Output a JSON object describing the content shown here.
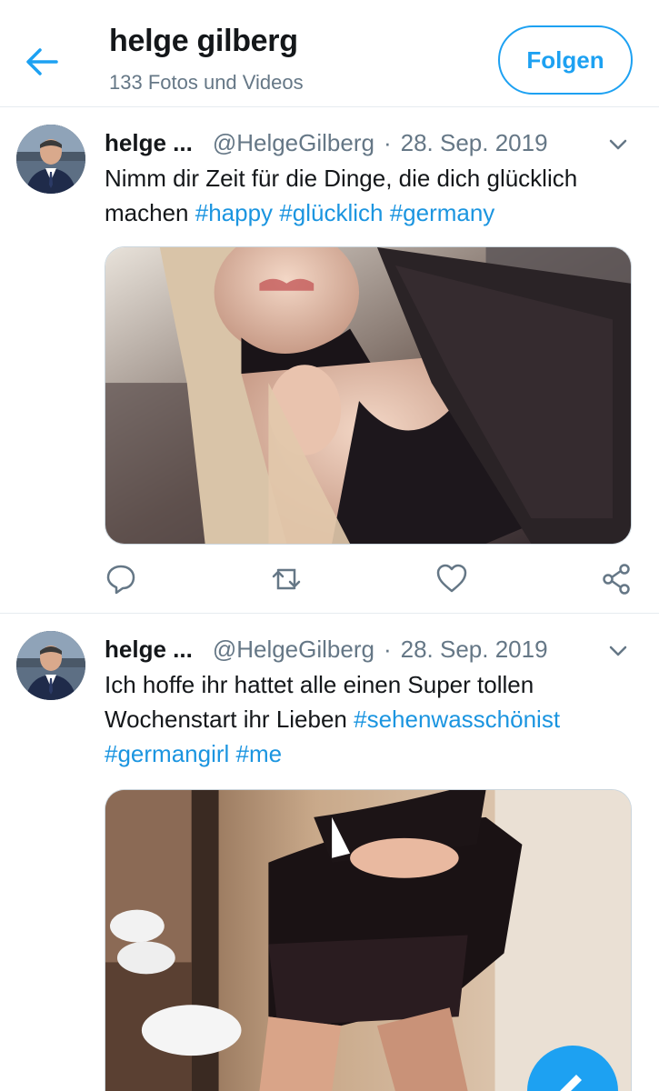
{
  "header": {
    "title": "helge gilberg",
    "subtitle": "133 Fotos und Videos",
    "follow_label": "Folgen"
  },
  "tweets": [
    {
      "name": "helge ...",
      "handle": "@HelgeGilberg",
      "separator": "·",
      "date": "28. Sep. 2019",
      "text_plain_1": "Nimm dir Zeit für die Dinge, die dich glücklich machen ",
      "hashtags": [
        "#happy",
        "#glücklich",
        "#germany"
      ],
      "media_description_icon": "photo-selfie-black-lace-top"
    },
    {
      "name": "helge ...",
      "handle": "@HelgeGilberg",
      "separator": "·",
      "date": "28. Sep. 2019",
      "text_plain_1": "Ich hoffe ihr hattet alle einen Super tollen Wochenstart ihr Lieben ",
      "hashtags": [
        "#sehenwasschönist",
        "#germangirl",
        "#me"
      ],
      "media_description_icon": "photo-mirror-selfie-black-dress"
    }
  ],
  "icons": {
    "back": "arrow-left-icon",
    "caret": "chevron-down-icon",
    "reply": "reply-icon",
    "retweet": "retweet-icon",
    "like": "heart-icon",
    "share": "share-icon",
    "compose": "compose-icon"
  },
  "colors": {
    "accent": "#1da1f2",
    "hashtag": "#1b95e0",
    "text": "#14171a",
    "secondary": "#657786",
    "divider": "#e6ecf0"
  }
}
